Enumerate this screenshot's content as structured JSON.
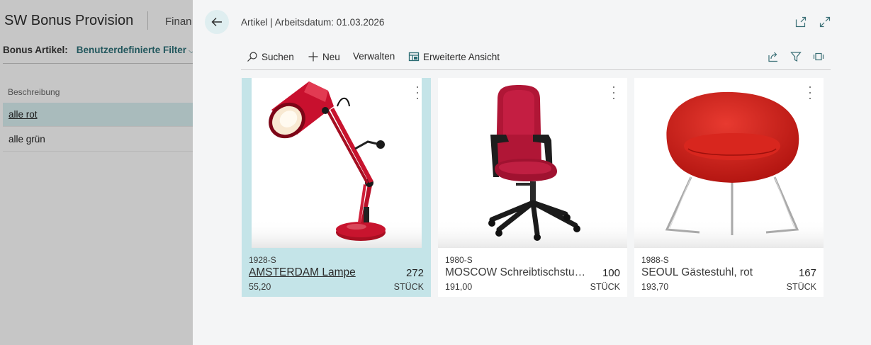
{
  "background": {
    "title": "SW Bonus Provision",
    "tab_partial": "Finan",
    "filter_label": "Bonus Artikel:",
    "filter_value": "Benutzerdefinierte Filter",
    "column_header": "Beschreibung",
    "rows": [
      "alle rot",
      "alle grün"
    ]
  },
  "dialog": {
    "title": "Artikel | Arbeitsdatum: 01.03.2026",
    "header_icons": [
      "open-in-new-window-icon",
      "expand-icon"
    ],
    "toolbar": {
      "search": "Suchen",
      "new": "Neu",
      "manage": "Verwalten",
      "advanced": "Erweiterte Ansicht",
      "right_icons": [
        "share-icon",
        "filter-icon",
        "layout-icon"
      ]
    },
    "tiles": [
      {
        "number": "1928-S",
        "name": "AMSTERDAM Lampe",
        "quantity": "272",
        "price": "55,20",
        "unit": "STÜCK",
        "selected": true,
        "image": "red-desk-lamp"
      },
      {
        "number": "1980-S",
        "name": "MOSCOW Schreibtischstuhl...",
        "quantity": "100",
        "price": "191,00",
        "unit": "STÜCK",
        "selected": false,
        "image": "red-office-chair"
      },
      {
        "number": "1988-S",
        "name": "SEOUL Gästestuhl, rot",
        "quantity": "167",
        "price": "193,70",
        "unit": "STÜCK",
        "selected": false,
        "image": "red-lounge-chair"
      }
    ]
  },
  "colors": {
    "accent": "#2a6b72",
    "selected_tile": "#c4e4e8",
    "product_red": "#c8102e"
  }
}
